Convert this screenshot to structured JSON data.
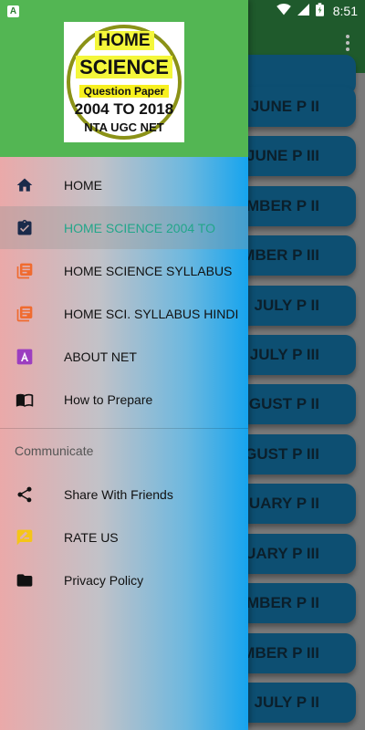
{
  "status_bar": {
    "notification_icon_letter": "A",
    "time": "8:51"
  },
  "background_app": {
    "buttons": [
      "JUNE P II",
      "JUNE P III",
      "CEMBER P II",
      "CEMBER P III",
      "JULY P II",
      "JULY P III",
      "UGUST P II",
      "UGUST P III",
      "ANUARY P II",
      "ANUARY P III",
      "VEMBER P II",
      "VEMBER P III",
      "JULY P II"
    ]
  },
  "drawer": {
    "logo": {
      "line1": "HOME",
      "line2": "SCIENCE",
      "line3": "Question Paper",
      "line4": "2004 TO 2018",
      "line5": "NTA UGC NET"
    },
    "items": [
      {
        "label": "HOME",
        "icon": "home-icon"
      },
      {
        "label": "HOME SCIENCE 2004 TO",
        "icon": "assignment-check-icon",
        "active": true
      },
      {
        "label": "HOME SCIENCE SYLLABUS",
        "icon": "document-icon"
      },
      {
        "label": "HOME SCI. SYLLABUS HINDI",
        "icon": "document-icon"
      },
      {
        "label": "ABOUT NET",
        "icon": "letter-a-icon"
      },
      {
        "label": "How to Prepare",
        "icon": "open-book-icon"
      }
    ],
    "section_title": "Communicate",
    "communicate_items": [
      {
        "label": "Share With Friends",
        "icon": "share-icon"
      },
      {
        "label": "RATE US",
        "icon": "rate-icon"
      },
      {
        "label": "Privacy Policy",
        "icon": "folder-icon"
      }
    ]
  },
  "colors": {
    "drawer_header": "#53b653",
    "active_text": "#22a68a",
    "toolbar": "#1f5a2c",
    "paper_button": "#0d4f72"
  }
}
